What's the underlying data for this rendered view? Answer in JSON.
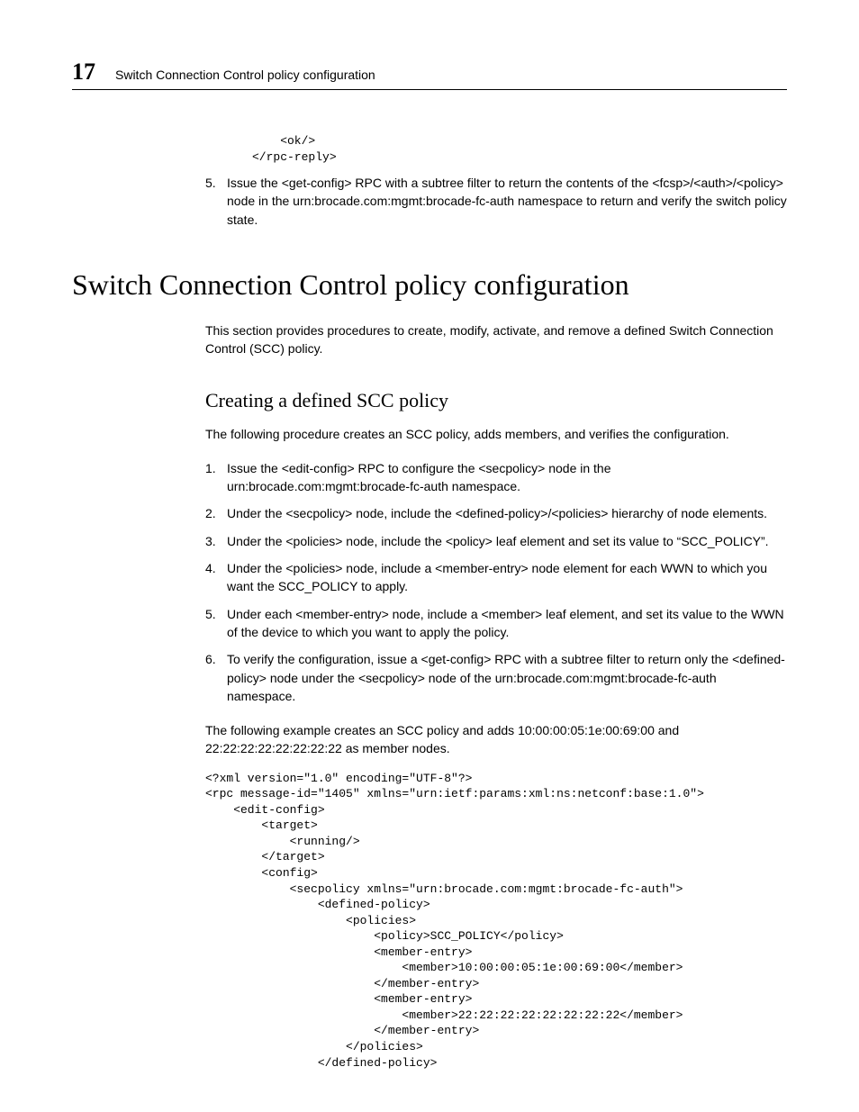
{
  "header": {
    "chapter_number": "17",
    "chapter_title": "Switch Connection Control policy configuration"
  },
  "top_code": "    <ok/>\n</rpc-reply>",
  "top_step": {
    "num": "5.",
    "text": "Issue the <get-config> RPC with a subtree filter to return the contents of the <fcsp>/<auth>/<policy> node in the urn:brocade.com:mgmt:brocade-fc-auth namespace to return and verify the switch policy state."
  },
  "section": {
    "heading": "Switch Connection Control policy configuration",
    "intro": "This section provides procedures to create, modify, activate, and remove a defined Switch Connection Control (SCC) policy.",
    "sub": {
      "heading": "Creating a defined SCC policy",
      "intro": "The following procedure creates an SCC policy, adds members, and verifies the configuration.",
      "steps": [
        {
          "num": "1.",
          "text": "Issue the <edit-config> RPC to configure the <secpolicy> node in the urn:brocade.com:mgmt:brocade-fc-auth namespace."
        },
        {
          "num": "2.",
          "text": "Under the <secpolicy> node, include the <defined-policy>/<policies> hierarchy of node elements."
        },
        {
          "num": "3.",
          "text": "Under the <policies> node, include the <policy> leaf element and set its value to “SCC_POLICY”."
        },
        {
          "num": "4.",
          "text": "Under the <policies> node, include a <member-entry> node element for each WWN to which you want the SCC_POLICY to apply."
        },
        {
          "num": "5.",
          "text": "Under each <member-entry> node, include a <member> leaf element, and set its value to the WWN of the device to which you want to apply the policy."
        },
        {
          "num": "6.",
          "text": "To verify the configuration, issue a <get-config> RPC with a subtree filter to return only the <defined-policy> node under the <secpolicy> node of the urn:brocade.com:mgmt:brocade-fc-auth namespace."
        }
      ],
      "example_intro": "The following example creates an SCC policy and adds 10:00:00:05:1e:00:69:00 and 22:22:22:22:22:22:22:22 as member nodes.",
      "code": "<?xml version=\"1.0\" encoding=\"UTF-8\"?>\n<rpc message-id=\"1405\" xmlns=\"urn:ietf:params:xml:ns:netconf:base:1.0\">\n    <edit-config>\n        <target>\n            <running/>\n        </target>\n        <config>\n            <secpolicy xmlns=\"urn:brocade.com:mgmt:brocade-fc-auth\">\n                <defined-policy>\n                    <policies>\n                        <policy>SCC_POLICY</policy>\n                        <member-entry>\n                            <member>10:00:00:05:1e:00:69:00</member>\n                        </member-entry>\n                        <member-entry>\n                            <member>22:22:22:22:22:22:22:22</member>\n                        </member-entry>\n                    </policies>\n                </defined-policy>"
    }
  }
}
